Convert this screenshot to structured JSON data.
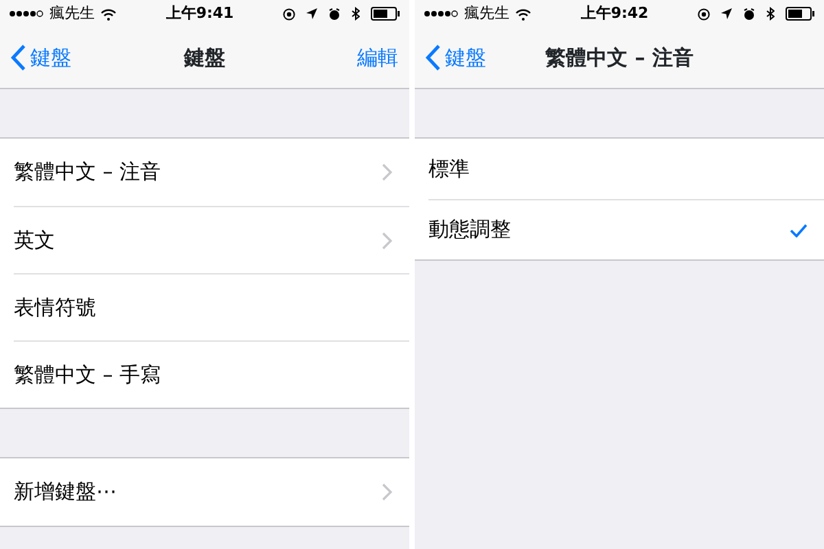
{
  "screens": [
    {
      "status_bar": {
        "carrier": "瘋先生",
        "time": "上午9:41"
      },
      "nav": {
        "back": "鍵盤",
        "title": "鍵盤",
        "action": "編輯"
      },
      "sections": [
        {
          "rows": [
            {
              "label": "繁體中文 – 注音",
              "kind": "disclosure"
            },
            {
              "label": "英文",
              "kind": "disclosure"
            },
            {
              "label": "表情符號",
              "kind": "plain"
            },
            {
              "label": "繁體中文 – 手寫",
              "kind": "plain"
            }
          ]
        },
        {
          "rows": [
            {
              "label": "新增鍵盤⋯",
              "kind": "disclosure"
            }
          ]
        }
      ]
    },
    {
      "status_bar": {
        "carrier": "瘋先生",
        "time": "上午9:42"
      },
      "nav": {
        "back": "鍵盤",
        "title": "繁體中文 – 注音"
      },
      "sections": [
        {
          "rows": [
            {
              "label": "標準",
              "kind": "option",
              "selected": false
            },
            {
              "label": "動態調整",
              "kind": "option",
              "selected": true
            }
          ]
        }
      ]
    }
  ]
}
